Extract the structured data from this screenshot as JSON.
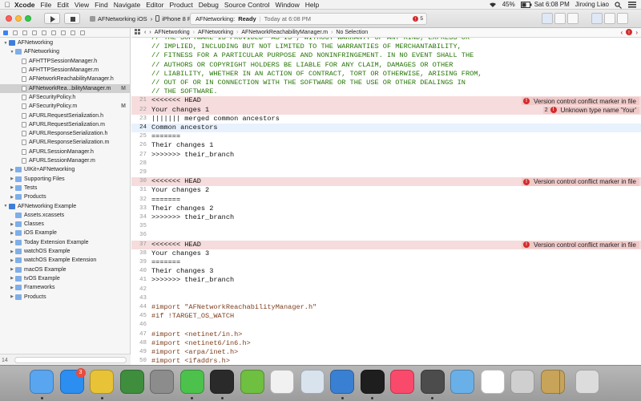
{
  "menubar": {
    "items": [
      "Xcode",
      "File",
      "Edit",
      "View",
      "Find",
      "Navigate",
      "Editor",
      "Product",
      "Debug",
      "Source Control",
      "Window",
      "Help"
    ],
    "battery": "45%",
    "clock": "Sat 6:08 PM",
    "user": "Jinxing Liao"
  },
  "toolbar": {
    "scheme": "AFNetworking iOS",
    "destination": "iPhone 8 Plus (11.0)",
    "activity_project": "AFNetworking:",
    "activity_status": "Ready",
    "activity_time": "Today at 6:08 PM",
    "activity_error_count": "5"
  },
  "navigator": {
    "rows": [
      {
        "label": "AFNetworking",
        "indent": 0,
        "kind": "proj",
        "expanded": true,
        "status": ""
      },
      {
        "label": "AFNetworking",
        "indent": 1,
        "kind": "folder",
        "expanded": true,
        "status": ""
      },
      {
        "label": "AFHTTPSessionManager.h",
        "indent": 2,
        "kind": "file",
        "status": ""
      },
      {
        "label": "AFHTTPSessionManager.m",
        "indent": 2,
        "kind": "filem",
        "status": ""
      },
      {
        "label": "AFNetworkReachabilityManager.h",
        "indent": 2,
        "kind": "file",
        "status": ""
      },
      {
        "label": "AFNetworkRea...bilityManager.m",
        "indent": 2,
        "kind": "filem",
        "status": "M",
        "selected": true
      },
      {
        "label": "AFSecurityPolicy.h",
        "indent": 2,
        "kind": "file",
        "status": ""
      },
      {
        "label": "AFSecurityPolicy.m",
        "indent": 2,
        "kind": "filem",
        "status": "M"
      },
      {
        "label": "AFURLRequestSerialization.h",
        "indent": 2,
        "kind": "file",
        "status": ""
      },
      {
        "label": "AFURLRequestSerialization.m",
        "indent": 2,
        "kind": "filem",
        "status": ""
      },
      {
        "label": "AFURLResponseSerialization.h",
        "indent": 2,
        "kind": "file",
        "status": ""
      },
      {
        "label": "AFURLResponseSerialization.m",
        "indent": 2,
        "kind": "filem",
        "status": ""
      },
      {
        "label": "AFURLSessionManager.h",
        "indent": 2,
        "kind": "file",
        "status": ""
      },
      {
        "label": "AFURLSessionManager.m",
        "indent": 2,
        "kind": "filem",
        "status": ""
      },
      {
        "label": "UIKit+AFNetworking",
        "indent": 1,
        "kind": "folder",
        "expanded": false,
        "status": ""
      },
      {
        "label": "Supporting Files",
        "indent": 1,
        "kind": "folder",
        "expanded": false,
        "status": ""
      },
      {
        "label": "Tests",
        "indent": 1,
        "kind": "folder",
        "expanded": false,
        "status": ""
      },
      {
        "label": "Products",
        "indent": 1,
        "kind": "folder",
        "expanded": false,
        "status": ""
      },
      {
        "label": "AFNetworking Example",
        "indent": 0,
        "kind": "proj",
        "expanded": true,
        "status": ""
      },
      {
        "label": "Assets.xcassets",
        "indent": 1,
        "kind": "folder",
        "status": ""
      },
      {
        "label": "Classes",
        "indent": 1,
        "kind": "folder",
        "expanded": false,
        "status": ""
      },
      {
        "label": "iOS Example",
        "indent": 1,
        "kind": "folder",
        "expanded": false,
        "status": ""
      },
      {
        "label": "Today Extension Example",
        "indent": 1,
        "kind": "folder",
        "expanded": false,
        "status": ""
      },
      {
        "label": "watchOS Example",
        "indent": 1,
        "kind": "folder",
        "expanded": false,
        "status": ""
      },
      {
        "label": "watchOS Example Extension",
        "indent": 1,
        "kind": "folder",
        "expanded": false,
        "status": ""
      },
      {
        "label": "macOS Example",
        "indent": 1,
        "kind": "folder",
        "expanded": false,
        "status": ""
      },
      {
        "label": "tvOS Example",
        "indent": 1,
        "kind": "folder",
        "expanded": false,
        "status": ""
      },
      {
        "label": "Frameworks",
        "indent": 1,
        "kind": "folder",
        "expanded": false,
        "status": ""
      },
      {
        "label": "Products",
        "indent": 1,
        "kind": "folder",
        "expanded": false,
        "status": ""
      }
    ]
  },
  "jumpbar": {
    "crumbs": [
      "AFNetworking",
      "AFNetworking",
      "AFNetworkReachabilityManager.m",
      "No Selection"
    ]
  },
  "editor": {
    "lines": [
      {
        "n": "",
        "text": "// THE SOFTWARE IS PROVIDED \"AS IS\", WITHOUT WARRANTY OF ANY KIND, EXPRESS OR",
        "cls": "c-comment"
      },
      {
        "n": "",
        "text": "// IMPLIED, INCLUDING BUT NOT LIMITED TO THE WARRANTIES OF MERCHANTABILITY,",
        "cls": "c-comment"
      },
      {
        "n": "",
        "text": "// FITNESS FOR A PARTICULAR PURPOSE AND NONINFRINGEMENT. IN NO EVENT SHALL THE",
        "cls": "c-comment"
      },
      {
        "n": "",
        "text": "// AUTHORS OR COPYRIGHT HOLDERS BE LIABLE FOR ANY CLAIM, DAMAGES OR OTHER",
        "cls": "c-comment"
      },
      {
        "n": "",
        "text": "// LIABILITY, WHETHER IN AN ACTION OF CONTRACT, TORT OR OTHERWISE, ARISING FROM,",
        "cls": "c-comment"
      },
      {
        "n": "",
        "text": "// OUT OF OR IN CONNECTION WITH THE SOFTWARE OR THE USE OR OTHER DEALINGS IN",
        "cls": "c-comment"
      },
      {
        "n": "",
        "text": "// THE SOFTWARE.",
        "cls": "c-comment"
      },
      {
        "n": "21",
        "text": "<<<<<<< HEAD",
        "cls": "c-plain",
        "row": "conflict",
        "issue": "Version control conflict marker in file"
      },
      {
        "n": "22",
        "text": "Your changes 1",
        "cls": "c-plain",
        "row": "conflict",
        "issue": "Unknown type name 'Your'",
        "issue_count": "2"
      },
      {
        "n": "23",
        "text": "||||||| merged common ancestors",
        "cls": "c-plain"
      },
      {
        "n": "24",
        "text": "Common ancestors",
        "cls": "c-plain",
        "row": "current"
      },
      {
        "n": "25",
        "text": "=======",
        "cls": "c-plain"
      },
      {
        "n": "26",
        "text": "Their changes 1",
        "cls": "c-plain"
      },
      {
        "n": "27",
        "text": ">>>>>>> their_branch",
        "cls": "c-plain"
      },
      {
        "n": "28",
        "text": "",
        "cls": "c-plain"
      },
      {
        "n": "29",
        "text": "",
        "cls": "c-plain"
      },
      {
        "n": "30",
        "text": "<<<<<<< HEAD",
        "cls": "c-plain",
        "row": "conflict",
        "issue": "Version control conflict marker in file"
      },
      {
        "n": "31",
        "text": "Your changes 2",
        "cls": "c-plain"
      },
      {
        "n": "32",
        "text": "=======",
        "cls": "c-plain"
      },
      {
        "n": "33",
        "text": "Their changes 2",
        "cls": "c-plain"
      },
      {
        "n": "34",
        "text": ">>>>>>> their_branch",
        "cls": "c-plain"
      },
      {
        "n": "35",
        "text": "",
        "cls": "c-plain"
      },
      {
        "n": "36",
        "text": "",
        "cls": "c-plain"
      },
      {
        "n": "37",
        "text": "<<<<<<< HEAD",
        "cls": "c-plain",
        "row": "conflict",
        "issue": "Version control conflict marker in file"
      },
      {
        "n": "38",
        "text": "Your changes 3",
        "cls": "c-plain"
      },
      {
        "n": "39",
        "text": "=======",
        "cls": "c-plain"
      },
      {
        "n": "40",
        "text": "Their changes 3",
        "cls": "c-plain"
      },
      {
        "n": "41",
        "text": ">>>>>>> their_branch",
        "cls": "c-plain"
      },
      {
        "n": "42",
        "text": "",
        "cls": "c-plain"
      },
      {
        "n": "43",
        "text": "",
        "cls": "c-plain"
      },
      {
        "n": "44",
        "text": "#import \"AFNetworkReachabilityManager.h\"",
        "cls": "c-pre"
      },
      {
        "n": "45",
        "text": "#if !TARGET_OS_WATCH",
        "cls": "c-pre"
      },
      {
        "n": "46",
        "text": "",
        "cls": "c-plain"
      },
      {
        "n": "47",
        "text": "#import <netinet/in.h>",
        "cls": "c-pre"
      },
      {
        "n": "48",
        "text": "#import <netinet6/in6.h>",
        "cls": "c-pre"
      },
      {
        "n": "49",
        "text": "#import <arpa/inet.h>",
        "cls": "c-pre"
      },
      {
        "n": "50",
        "text": "#import <ifaddrs.h>",
        "cls": "c-pre"
      }
    ]
  },
  "navigator_line_count": "14",
  "dock": {
    "apps": [
      {
        "name": "Finder",
        "color": "#5aa5ef"
      },
      {
        "name": "App Store",
        "color": "#2b8ef0",
        "badge": "3"
      },
      {
        "name": "Chrome",
        "color": "#e8c337"
      },
      {
        "name": "Xbox",
        "color": "#3e8e3e"
      },
      {
        "name": "System Preferences",
        "color": "#8c8c8c"
      },
      {
        "name": "WeChat",
        "color": "#4cc24c"
      },
      {
        "name": "Terminal",
        "color": "#2a2a2a"
      },
      {
        "name": "Evernote",
        "color": "#6fbf40"
      },
      {
        "name": "Slack",
        "color": "#f1f1f1"
      },
      {
        "name": "Preview",
        "color": "#d9e3ee"
      },
      {
        "name": "Xcode",
        "color": "#3a80d2"
      },
      {
        "name": "IntelliJ IDEA",
        "color": "#1e1e1e"
      },
      {
        "name": "Music",
        "color": "#fa4a6b"
      },
      {
        "name": "Sublime Text",
        "color": "#4c4c4c"
      },
      {
        "name": "Launchpad",
        "color": "#6ab0e8"
      },
      {
        "name": "Xcode Beta",
        "color": "#ffffff"
      },
      {
        "name": "Instruments",
        "color": "#cfcfcf"
      },
      {
        "name": "Archive Utility",
        "color": "#c7a45a"
      },
      {
        "name": "Trash",
        "color": "#dcdcdc"
      }
    ]
  }
}
